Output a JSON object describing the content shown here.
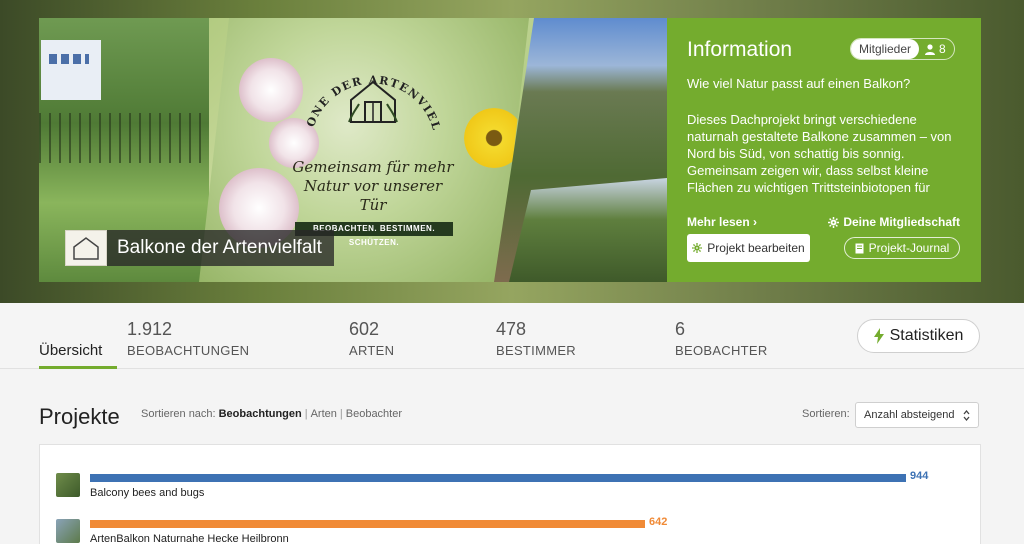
{
  "colors": {
    "accent_green": "#74ac2e",
    "bar_blue": "#3d72b4",
    "bar_orange": "#f08a36"
  },
  "banner": {
    "logo_arc_text": "BALKONE DER ARTENVIELFALT",
    "logo_tagline_1": "Gemeinsam für mehr",
    "logo_tagline_2": "Natur vor unserer Tür",
    "logo_strip": "BEOBACHTEN. BESTIMMEN. SCHÜTZEN.",
    "project_name": "Balkone der Artenvielfalt"
  },
  "info": {
    "title": "Information",
    "members_label": "Mitglieder",
    "members_count": "8",
    "question": "Wie viel Natur passt auf einen Balkon?",
    "text": "Dieses Dachprojekt bringt verschiedene naturnah gestaltete Balkone zusammen – von Nord bis Süd, von schattig bis sonnig. Gemeinsam zeigen wir, dass selbst kleine Flächen zu wichtigen Trittsteinbiotopen für",
    "read_more": "Mehr lesen ›",
    "membership": "Deine Mitgliedschaft",
    "edit_button": "Projekt bearbeiten",
    "journal_button": "Projekt-Journal"
  },
  "stats": {
    "overview_tab": "Übersicht",
    "items": [
      {
        "num": "1.912",
        "label": "BEOBACHTUNGEN"
      },
      {
        "num": "602",
        "label": "ARTEN"
      },
      {
        "num": "478",
        "label": "BESTIMMER"
      },
      {
        "num": "6",
        "label": "BEOBACHTER"
      }
    ],
    "stats_button": "Statistiken"
  },
  "projects": {
    "title": "Projekte",
    "sort_by_label": "Sortieren nach:",
    "sort_options": [
      "Beobachtungen",
      "Arten",
      "Beobachter"
    ],
    "sort_label": "Sortieren:",
    "sort_value": "Anzahl absteigend",
    "max_value": 944,
    "rows": [
      {
        "name": "Balcony bees and bugs",
        "value": 944
      },
      {
        "name": "ArtenBalkon Naturnahe Hecke Heilbronn",
        "value": 642
      }
    ]
  }
}
